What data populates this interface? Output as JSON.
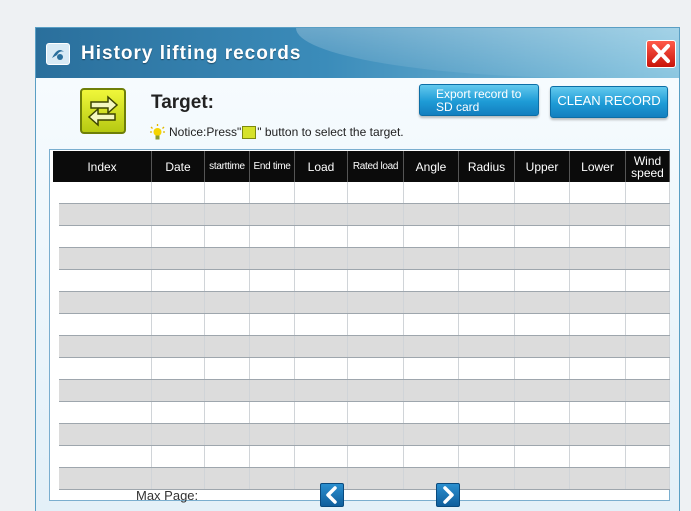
{
  "window": {
    "title": "History lifting records"
  },
  "target": {
    "label": "Target:"
  },
  "notice": {
    "prefix": "Notice:Press\"",
    "suffix": "\" button to select the target."
  },
  "buttons": {
    "export": "Export record to SD card",
    "clean": "CLEAN RECORD"
  },
  "table": {
    "columns": [
      "Index",
      "Date",
      "starttime",
      "End time",
      "Load",
      "Rated load",
      "Angle",
      "Radius",
      "Upper",
      "Lower",
      "Wind speed"
    ],
    "rows": []
  },
  "pagination": {
    "max_page_label": "Max Page:"
  },
  "colors": {
    "header_bg": "#0b0b0b",
    "accent_blue": "#1e9bd6",
    "close_red": "#d8261b",
    "swap_yellow": "#d6e22a"
  }
}
